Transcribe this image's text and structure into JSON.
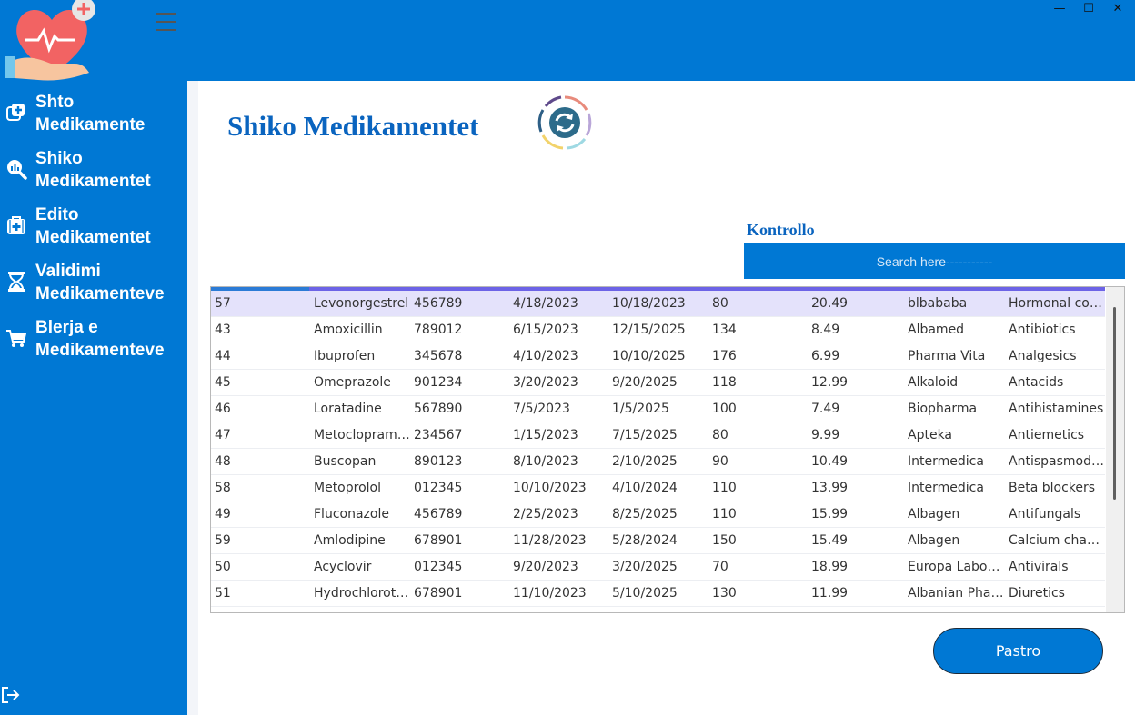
{
  "window": {
    "minimize": "—",
    "maximize": "☐",
    "close": "✕"
  },
  "colors": {
    "brand": "#0078d4",
    "title": "#0a64bf",
    "selected_row": "#e4e2fb"
  },
  "sidebar": {
    "items": [
      {
        "label": "Shto\nMedikamente",
        "icon": "add-medicine-icon"
      },
      {
        "label": "Shiko\nMedikamentet",
        "icon": "search-chart-icon"
      },
      {
        "label": "Edito\nMedikamentet",
        "icon": "medical-bag-icon"
      },
      {
        "label": "Validimi\nMedikamenteve",
        "icon": "hourglass-icon"
      },
      {
        "label": "Blerja e\nMedikamenteve",
        "icon": "cart-icon"
      }
    ],
    "logout_icon": "logout-icon"
  },
  "main": {
    "title": "Shiko Medikamentet",
    "refresh_icon": "refresh-icon",
    "search_label": "Kontrollo",
    "search_placeholder": "Search here-----------",
    "clear_button": "Pastro"
  },
  "table": {
    "rows": [
      [
        "57",
        "Levonorgestrel",
        "456789",
        "4/18/2023",
        "10/18/2023",
        "80",
        "20.49",
        "blbababa",
        "Hormonal co…"
      ],
      [
        "43",
        "Amoxicillin",
        "789012",
        "6/15/2023",
        "12/15/2025",
        "134",
        "8.49",
        "Albamed",
        "Antibiotics"
      ],
      [
        "44",
        "Ibuprofen",
        "345678",
        "4/10/2023",
        "10/10/2025",
        "176",
        "6.99",
        "Pharma Vita",
        "Analgesics"
      ],
      [
        "45",
        "Omeprazole",
        "901234",
        "3/20/2023",
        "9/20/2025",
        "118",
        "12.99",
        "Alkaloid",
        "Antacids"
      ],
      [
        "46",
        "Loratadine",
        "567890",
        "7/5/2023",
        "1/5/2025",
        "100",
        "7.49",
        "Biopharma",
        "Antihistamines"
      ],
      [
        "47",
        "Metoclopram…",
        "234567",
        "1/15/2023",
        "7/15/2025",
        "80",
        "9.99",
        "Apteka",
        "Antiemetics"
      ],
      [
        "48",
        "Buscopan",
        "890123",
        "8/10/2023",
        "2/10/2025",
        "90",
        "10.49",
        "Intermedica",
        "Antispasmodi…"
      ],
      [
        "58",
        "Metoprolol",
        "012345",
        "10/10/2023",
        "4/10/2024",
        "110",
        "13.99",
        "Intermedica",
        "Beta blockers"
      ],
      [
        "49",
        "Fluconazole",
        "456789",
        "2/25/2023",
        "8/25/2025",
        "110",
        "15.99",
        "Albagen",
        "Antifungals"
      ],
      [
        "59",
        "Amlodipine",
        "678901",
        "11/28/2023",
        "5/28/2024",
        "150",
        "15.49",
        "Albagen",
        "Calcium chan…"
      ],
      [
        "50",
        "Acyclovir",
        "012345",
        "9/20/2023",
        "3/20/2025",
        "70",
        "18.99",
        "Europa Labor…",
        "Antivirals"
      ],
      [
        "51",
        "Hydrochlorot…",
        "678901",
        "11/10/2023",
        "5/10/2025",
        "130",
        "11.99",
        "Albanian Phar…",
        "Diuretics"
      ]
    ],
    "selected_index": 0
  }
}
